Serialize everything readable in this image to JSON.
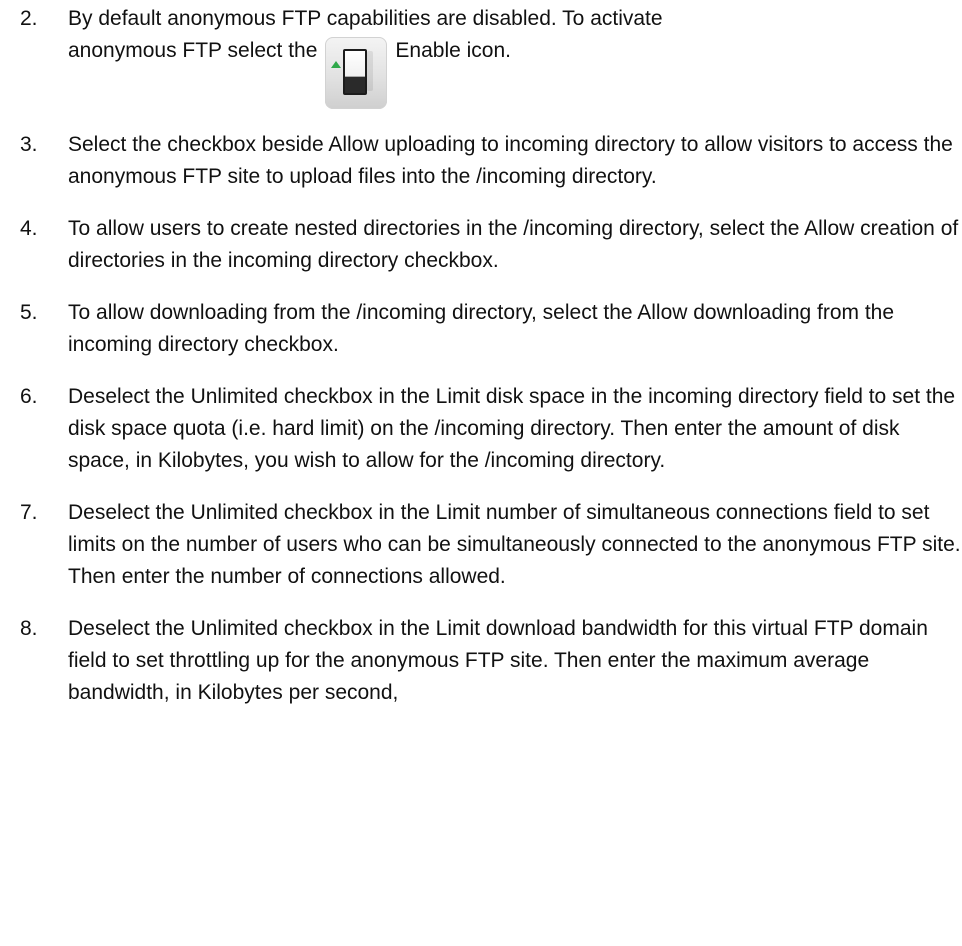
{
  "steps": [
    {
      "number": "2.",
      "line1": "By default anonymous FTP capabilities are disabled. To activate",
      "line2_before": "anonymous FTP select the",
      "icon": "enable-switch-icon",
      "line2_after": "Enable icon."
    },
    {
      "number": "3.",
      "text": "Select the checkbox beside Allow uploading to incoming directory to allow visitors to access the anonymous FTP site to upload files into the /incoming directory."
    },
    {
      "number": "4.",
      "text": "To allow users to create nested directories in the /incoming directory, select the Allow creation of directories in the incoming directory checkbox."
    },
    {
      "number": "5.",
      "text": "To allow downloading from the /incoming directory, select the Allow downloading from the incoming directory checkbox."
    },
    {
      "number": "6.",
      "text": "Deselect the Unlimited checkbox in the Limit disk space in the incoming directory field to set the disk space quota (i.e. hard limit) on the /incoming directory. Then enter the amount of disk space, in Kilobytes, you wish to allow for the /incoming directory."
    },
    {
      "number": "7.",
      "text": "Deselect the Unlimited checkbox in the Limit number of simultaneous connections field to set limits on the number of users who can be simultaneously connected to the anonymous FTP site. Then enter the number of connections allowed."
    },
    {
      "number": "8.",
      "text": "Deselect the Unlimited checkbox in the Limit download bandwidth for this virtual FTP domain field to set throttling up for the anonymous FTP site. Then enter the maximum average bandwidth, in Kilobytes per second,"
    }
  ]
}
